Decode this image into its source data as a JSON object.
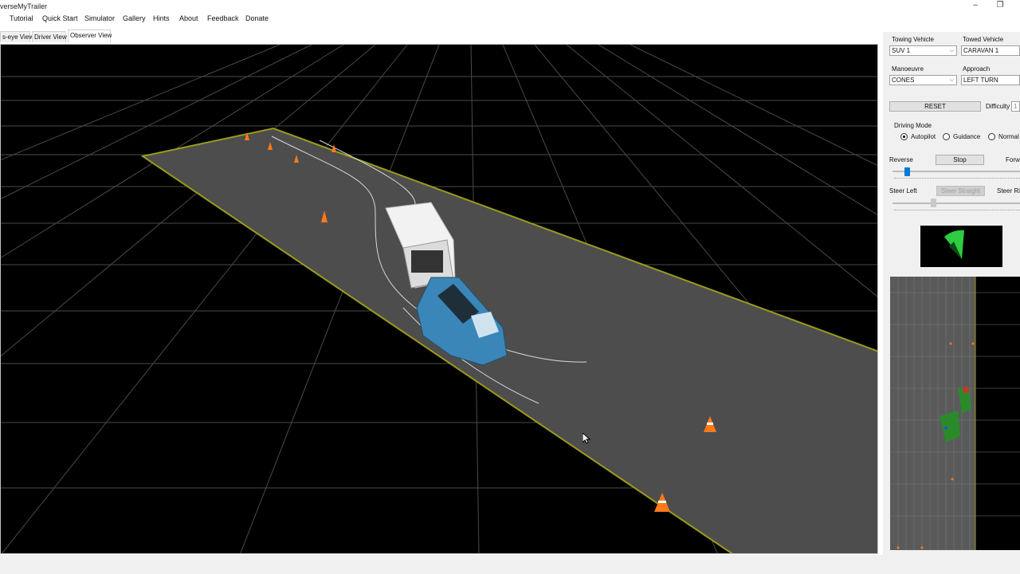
{
  "window": {
    "title": "verseMyTrailer",
    "minimize_icon": "minimize-icon",
    "restore_icon": "restore-icon"
  },
  "menu": [
    "Tutorial",
    "Quick Start",
    "Simulator",
    "Gallery",
    "Hints",
    "About",
    "Feedback",
    "Donate"
  ],
  "tabs": [
    "s-eye View",
    "Driver View",
    "Observer View"
  ],
  "panel": {
    "towing_label": "Towing Vehicle",
    "towing_value": "SUV 1",
    "towed_label": "Towed Vehicle",
    "towed_value": "CARAVAN 1",
    "manoeuvre_label": "Manoeuvre",
    "manoeuvre_value": "CONES",
    "approach_label": "Approach",
    "approach_value": "LEFT TURN",
    "reset_label": "RESET",
    "difficulty_label": "Difficulty",
    "difficulty_value": "1",
    "driving_mode_label": "Driving Mode",
    "modes": [
      "Autopilot",
      "Guidance",
      "Normal"
    ],
    "selected_mode": "Autopilot",
    "reverse_label": "Reverse",
    "stop_label": "Stop",
    "forward_label": "Forwa",
    "steer_left_label": "Steer Left",
    "steer_straight_label": "Steer Straight",
    "steer_right_label": "Steer Rig",
    "speed_level": 0.18,
    "steer_level": 0.5
  },
  "colors": {
    "accent": "#0078d7",
    "cone": "#ff7a1a",
    "car": "#3b86b8",
    "ground_edge": "#9c9a1c",
    "steer_indicator": "#2ecc40"
  }
}
